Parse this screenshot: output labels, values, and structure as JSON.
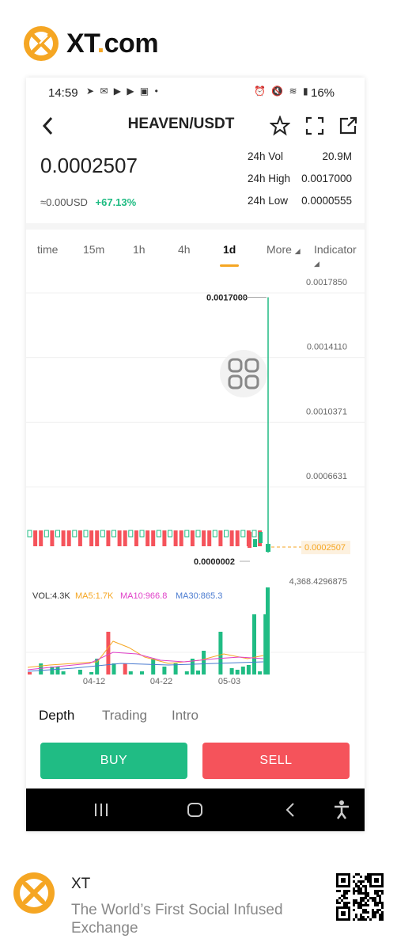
{
  "brand": {
    "name_main": "XT",
    "name_dot": ".",
    "name_tail": "com"
  },
  "status": {
    "time": "14:59",
    "battery": "16%"
  },
  "header": {
    "pair": "HEAVEN/USDT"
  },
  "ticker": {
    "price": "0.0002507",
    "usd": "≈0.00USD",
    "change": "+67.13%",
    "vol_label": "24h Vol",
    "vol_value": "20.9M",
    "high_label": "24h High",
    "high_value": "0.0017000",
    "low_label": "24h Low",
    "low_value": "0.0000555"
  },
  "tabs": [
    "time",
    "15m",
    "1h",
    "4h",
    "1d",
    "More",
    "Indicator"
  ],
  "active_tab": "1d",
  "chart_data": {
    "type": "candlestick",
    "y_ticks": [
      "0.0017850",
      "0.0014110",
      "0.0010371",
      "0.0006631",
      "0.0002507"
    ],
    "y_tick_values": [
      0.001785,
      0.001411,
      0.0010371,
      0.0006631,
      0.0002507
    ],
    "last_price": 0.0002507,
    "high_annotation": "0.0017000",
    "low_annotation": "0.0000002",
    "volume_max_label": "4,368.4296875",
    "x_tick_labels": [
      "04-12",
      "04-22",
      "05-03"
    ],
    "indicators": {
      "vol": "VOL:4.3K",
      "ma5": "MA5:1.7K",
      "ma10": "MA10:966.8",
      "ma30": "MA30:865.3"
    },
    "colors": {
      "up": "#20bc84",
      "down": "#f5535b",
      "ma5": "#f5a623",
      "ma10": "#e040c8",
      "ma30": "#4a7bd0"
    }
  },
  "bottom_tabs": [
    "Depth",
    "Trading",
    "Intro"
  ],
  "buttons": {
    "buy": "BUY",
    "sell": "SELL"
  },
  "footer": {
    "name": "XT",
    "tagline": "The World’s First Social Infused Exchange"
  }
}
